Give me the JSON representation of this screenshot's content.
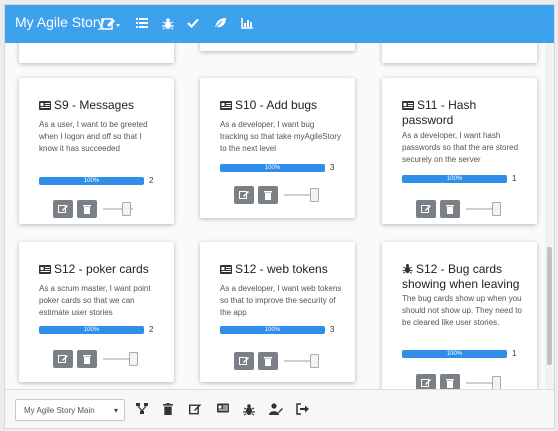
{
  "topbar": {
    "title": "My Agile Story",
    "icons": [
      "edit-dropdown-icon",
      "list-icon",
      "bug-icon",
      "check-icon",
      "leaf-icon",
      "chart-icon"
    ]
  },
  "colors": {
    "primary": "#3ea1ee",
    "progress": "#2f8ee8",
    "button": "#7a8086"
  },
  "cards": [
    {
      "title": "S9 - Messages",
      "icon": "card-icon",
      "description": "As a user, I want to be greeted when I logon and off so that I know it has succeeded",
      "progress_label": "100%",
      "progress": 1.0,
      "points": "2"
    },
    {
      "title": "S10 - Add bugs",
      "icon": "card-icon",
      "description": "As a developer, I want bug tracking so that take myAgileStory to the next level",
      "progress_label": "100%",
      "progress": 1.0,
      "points": "3"
    },
    {
      "title": "S11 - Hash password",
      "icon": "card-icon",
      "description": "As a developer, I want hash passwords so that the are stored securely on the server",
      "progress_label": "100%",
      "progress": 1.0,
      "points": "1"
    },
    {
      "title": "S12 - poker cards",
      "icon": "card-icon",
      "description": "As a scrum master, I want point poker cards so that we can estimate user stories",
      "progress_label": "100%",
      "progress": 1.0,
      "points": "2"
    },
    {
      "title": "S12 - web tokens",
      "icon": "card-icon",
      "description": "As a developer, I want web tokens so that to improve the security of the app",
      "progress_label": "100%",
      "progress": 1.0,
      "points": "3"
    },
    {
      "title": "S12 - Bug cards showing when leaving",
      "icon": "bug-icon",
      "description": "The bug cards show up when you should not show up. They need to be cleared like user stories.",
      "progress_label": "100%",
      "progress": 1.0,
      "points": "1"
    }
  ],
  "footer": {
    "project_select": "My Agile Story Main",
    "icons": [
      "sitemap-icon",
      "trash-icon",
      "edit-icon",
      "card-icon",
      "bug-icon",
      "user-edit-icon",
      "sign-out-icon"
    ]
  }
}
